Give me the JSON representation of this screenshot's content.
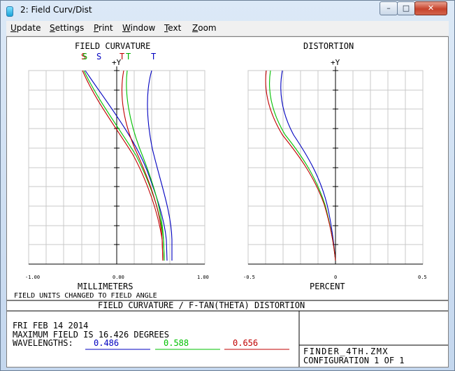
{
  "window": {
    "title": "2: Field Curv/Dist",
    "controls": {
      "minimize": "–",
      "maximize": "□",
      "close": "✕"
    }
  },
  "menu": [
    {
      "label": "Update",
      "accel": "U",
      "rest": "pdate"
    },
    {
      "label": "Settings",
      "accel": "S",
      "rest": "ettings"
    },
    {
      "label": "Print",
      "accel": "P",
      "rest": "rint"
    },
    {
      "label": "Window",
      "accel": "W",
      "rest": "indow"
    },
    {
      "label": "Text",
      "accel": "T",
      "rest": "ext"
    },
    {
      "label": "Zoom",
      "accel": "Z",
      "rest": "oom"
    }
  ],
  "plot": {
    "fc_title": "FIELD CURVATURE",
    "dist_title": "DISTORTION",
    "y_axis_label": "+Y",
    "fc_legend": [
      {
        "text": "S",
        "color": "#c00000"
      },
      {
        "text": "S",
        "color": "#00b000"
      },
      {
        "text": "S",
        "color": "#0000c0"
      },
      {
        "text": "T",
        "color": "#c00000"
      },
      {
        "text": "T",
        "color": "#00b000"
      },
      {
        "text": "T",
        "color": "#0000c0"
      }
    ],
    "fc_ticks": [
      "-1.00",
      "0.00",
      "1.00"
    ],
    "dist_ticks": [
      "-0.5",
      "0",
      "0.5"
    ],
    "fc_xlabel": "MILLIMETERS",
    "fc_note": "FIELD UNITS CHANGED TO FIELD ANGLE",
    "dist_xlabel": "PERCENT"
  },
  "banner": "FIELD CURVATURE / F-TAN(THETA) DISTORTION",
  "info": {
    "date": "FRI FEB 14 2014",
    "max_field": "MAXIMUM FIELD IS 16.426 DEGREES",
    "wavelengths_label": "WAVELENGTHS:",
    "wavelengths": [
      {
        "value": "0.486",
        "color": "#0000c0"
      },
      {
        "value": "0.588",
        "color": "#00c000"
      },
      {
        "value": "0.656",
        "color": "#c00000"
      }
    ],
    "filename": "FINDER_4TH.ZMX",
    "configuration": "CONFIGURATION 1 OF 1"
  },
  "colors": {
    "blue": "#0000c0",
    "green": "#00c000",
    "red": "#c00000"
  }
}
